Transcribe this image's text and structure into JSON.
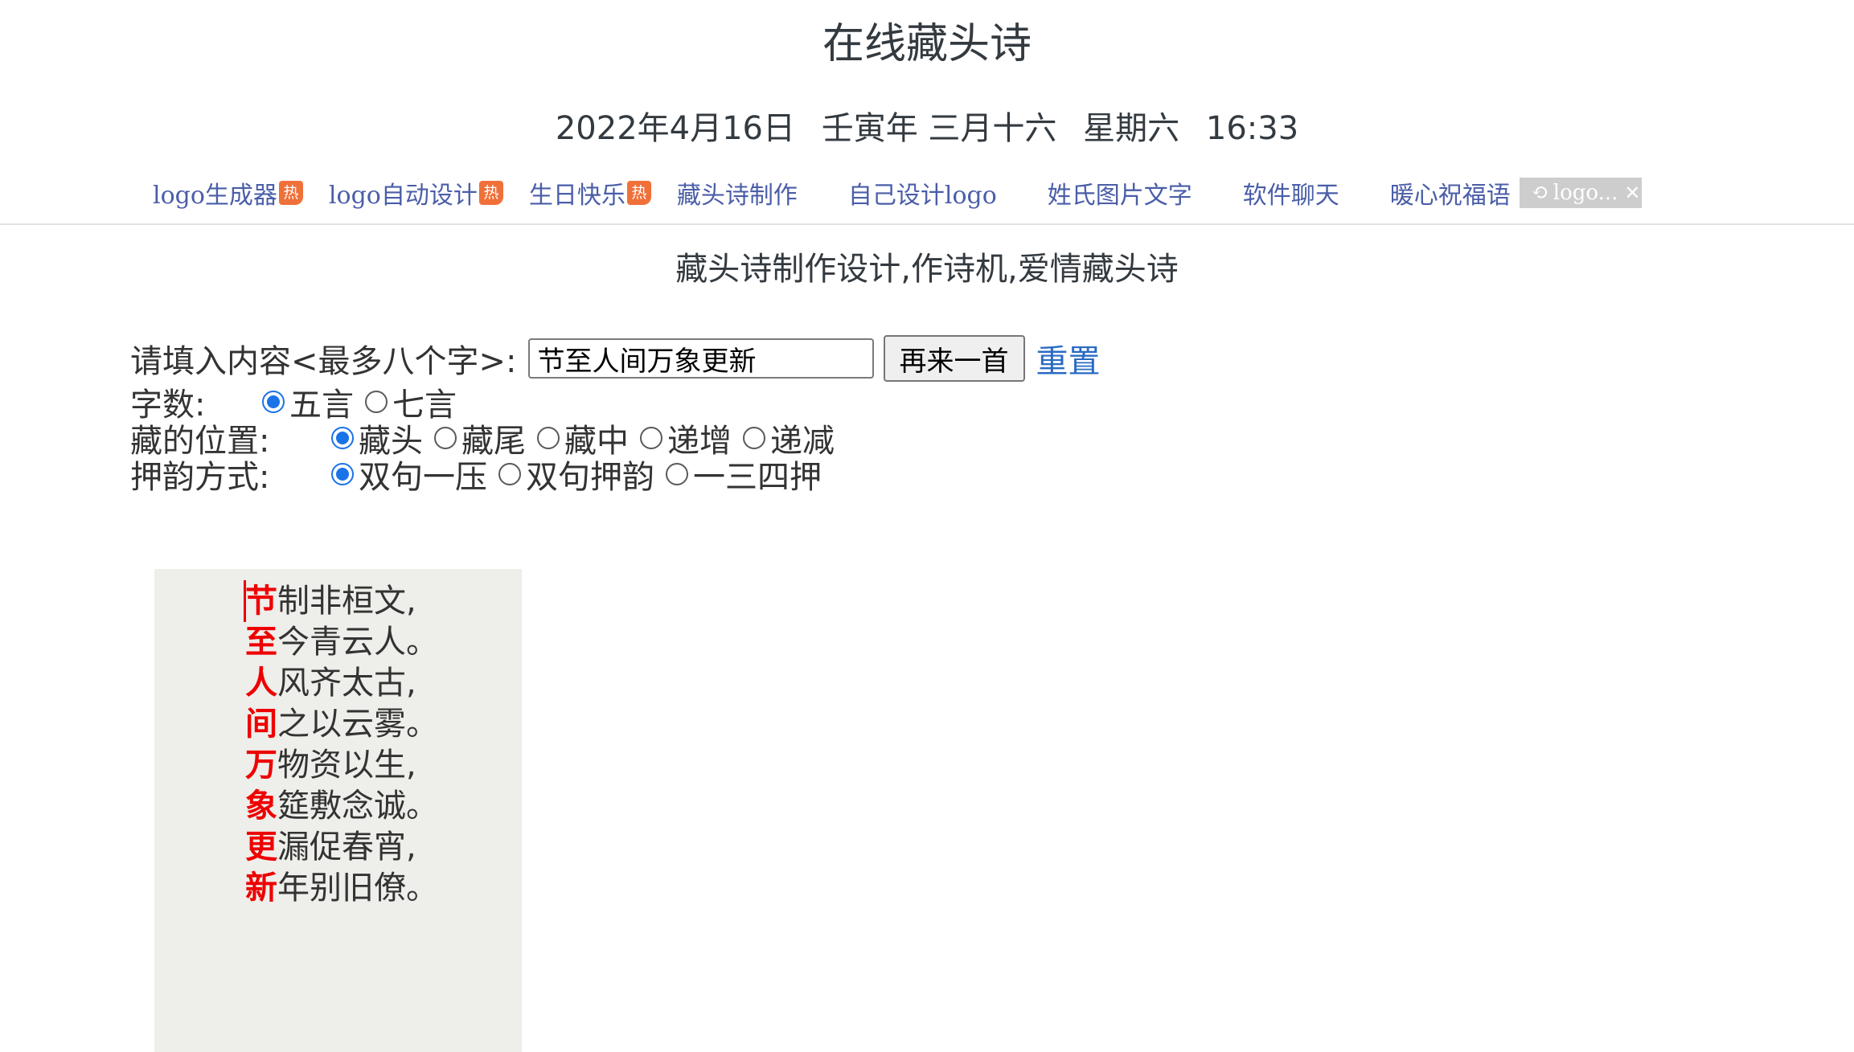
{
  "header": {
    "title": "在线藏头诗",
    "date": "2022年4月16日",
    "lunar": "壬寅年 三月十六",
    "weekday": "星期六",
    "time": "16:33"
  },
  "nav": {
    "items": [
      {
        "label": "logo生成器",
        "hot": true
      },
      {
        "label": "logo自动设计",
        "hot": true
      },
      {
        "label": "生日快乐",
        "hot": true
      },
      {
        "label": "藏头诗制作",
        "hot": false
      },
      {
        "label": "自己设计logo",
        "hot": false
      },
      {
        "label": "姓氏图片文字",
        "hot": false
      },
      {
        "label": "软件聊天",
        "hot": false
      },
      {
        "label": "暖心祝福语",
        "hot": false
      }
    ],
    "hot_badge": "热",
    "ad": {
      "text": "logo...",
      "icon": "ad-choices-icon",
      "close": "✕"
    }
  },
  "subtitle": "藏头诗制作设计,作诗机,爱情藏头诗",
  "form": {
    "content_label": "请填入内容<最多八个字>:",
    "content_value": "节至人间万象更新",
    "again_button": "再来一首",
    "reset_link": "重置",
    "word_count": {
      "label": "字数:",
      "options": [
        {
          "label": "五言",
          "selected": true
        },
        {
          "label": "七言",
          "selected": false
        }
      ]
    },
    "position": {
      "label": "藏的位置:",
      "options": [
        {
          "label": "藏头",
          "selected": true
        },
        {
          "label": "藏尾",
          "selected": false
        },
        {
          "label": "藏中",
          "selected": false
        },
        {
          "label": "递增",
          "selected": false
        },
        {
          "label": "递减",
          "selected": false
        }
      ]
    },
    "rhyme": {
      "label": "押韵方式:",
      "options": [
        {
          "label": "双句一压",
          "selected": true
        },
        {
          "label": "双句押韵",
          "selected": false
        },
        {
          "label": "一三四押",
          "selected": false
        }
      ]
    }
  },
  "poem": {
    "lines": [
      {
        "head": "节",
        "rest": "制非桓文,"
      },
      {
        "head": "至",
        "rest": "今青云人。"
      },
      {
        "head": "人",
        "rest": "风齐太古,"
      },
      {
        "head": "间",
        "rest": "之以云雾。"
      },
      {
        "head": "万",
        "rest": "物资以生,"
      },
      {
        "head": "象",
        "rest": "筵敷念诚。"
      },
      {
        "head": "更",
        "rest": "漏促春宵,"
      },
      {
        "head": "新",
        "rest": "年别旧僚。"
      }
    ]
  },
  "colors": {
    "link": "#4a5ea8",
    "accent": "#1a73e8",
    "head_char": "#ee0000",
    "poem_bg": "#eeeeea",
    "hot_badge": "#f0703a"
  }
}
